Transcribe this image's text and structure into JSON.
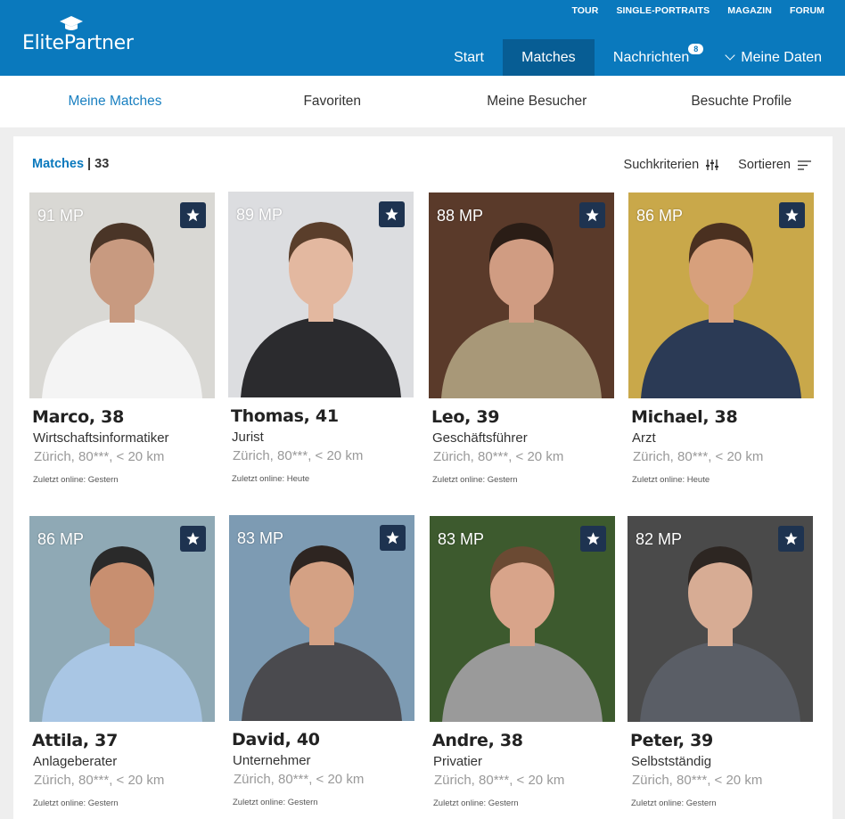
{
  "header": {
    "logo": "ElitePartner",
    "toplinks": [
      "TOUR",
      "SINGLE-PORTRAITS",
      "MAGAZIN",
      "FORUM"
    ],
    "nav": {
      "start": "Start",
      "matches": "Matches",
      "messages": "Nachrichten",
      "messages_badge": "8",
      "mydata": "Meine Daten"
    }
  },
  "subnav": [
    "Meine Matches",
    "Favoriten",
    "Meine Besucher",
    "Besuchte Profile"
  ],
  "toolbar": {
    "title": "Matches",
    "separator": " | ",
    "count": "33",
    "search_criteria": "Suchkriterien",
    "sort": "Sortieren"
  },
  "colors": {
    "brand": "#0a79bd",
    "nav_active": "#075d94",
    "star_bg": "#1e3350",
    "subnav_active": "#1a80c1"
  },
  "cards": [
    {
      "mp": "91 MP",
      "name": "Marco, 38",
      "job": "Wirtschaftsinformatiker",
      "location": "Zürich, 80***, < 20  km",
      "online": "Zuletzt online: Gestern",
      "bg": "#d9d8d4",
      "skin": "#c89a80",
      "hair": "#4a3527",
      "shirt": "#f4f4f4"
    },
    {
      "mp": "89 MP",
      "name": "Thomas, 41",
      "job": "Jurist",
      "location": "Zürich, 80***, < 20 km",
      "online": "Zuletzt online: Heute",
      "bg": "#dcdde0",
      "skin": "#e3b8a0",
      "hair": "#5a3e2b",
      "shirt": "#2b2b2e"
    },
    {
      "mp": "88 MP",
      "name": "Leo, 39",
      "job": "Geschäftsführer",
      "location": "Zürich, 80***, < 20 km",
      "online": "Zuletzt online: Gestern",
      "bg": "#5a3a2a",
      "skin": "#d09c82",
      "hair": "#2a1d16",
      "shirt": "#a89878"
    },
    {
      "mp": "86 MP",
      "name": "Michael, 38",
      "job": "Arzt",
      "location": "Zürich, 80***, < 20 km",
      "online": "Zuletzt online: Heute",
      "bg": "#c9a84a",
      "skin": "#d7a07c",
      "hair": "#4a3020",
      "shirt": "#2b3a55"
    },
    {
      "mp": "86 MP",
      "name": "Attila, 37",
      "job": "Anlageberater",
      "location": "Zürich, 80***, < 20 km",
      "online": "Zuletzt online: Gestern",
      "bg": "#8fa9b5",
      "skin": "#c88f70",
      "hair": "#2a2a2a",
      "shirt": "#a9c6e4"
    },
    {
      "mp": "83 MP",
      "name": "David, 40",
      "job": "Unternehmer",
      "location": "Zürich, 80***, < 20 km",
      "online": "Zuletzt online: Gestern",
      "bg": "#7d9bb3",
      "skin": "#d4a184",
      "hair": "#2e2521",
      "shirt": "#4a4a4e"
    },
    {
      "mp": "83 MP",
      "name": "Andre, 38",
      "job": "Privatier",
      "location": "Zürich, 80***, < 20 km",
      "online": "Zuletzt online: Gestern",
      "bg": "#3d5a2e",
      "skin": "#d8a48a",
      "hair": "#6b4a33",
      "shirt": "#9a9a9a"
    },
    {
      "mp": "82 MP",
      "name": "Peter, 39",
      "job": "Selbstständig",
      "location": "Zürich, 80***, < 20 km",
      "online": "Zuletzt online: Gestern",
      "bg": "#4a4a4a",
      "skin": "#d7ac94",
      "hair": "#2d2622",
      "shirt": "#5a5e66"
    }
  ]
}
